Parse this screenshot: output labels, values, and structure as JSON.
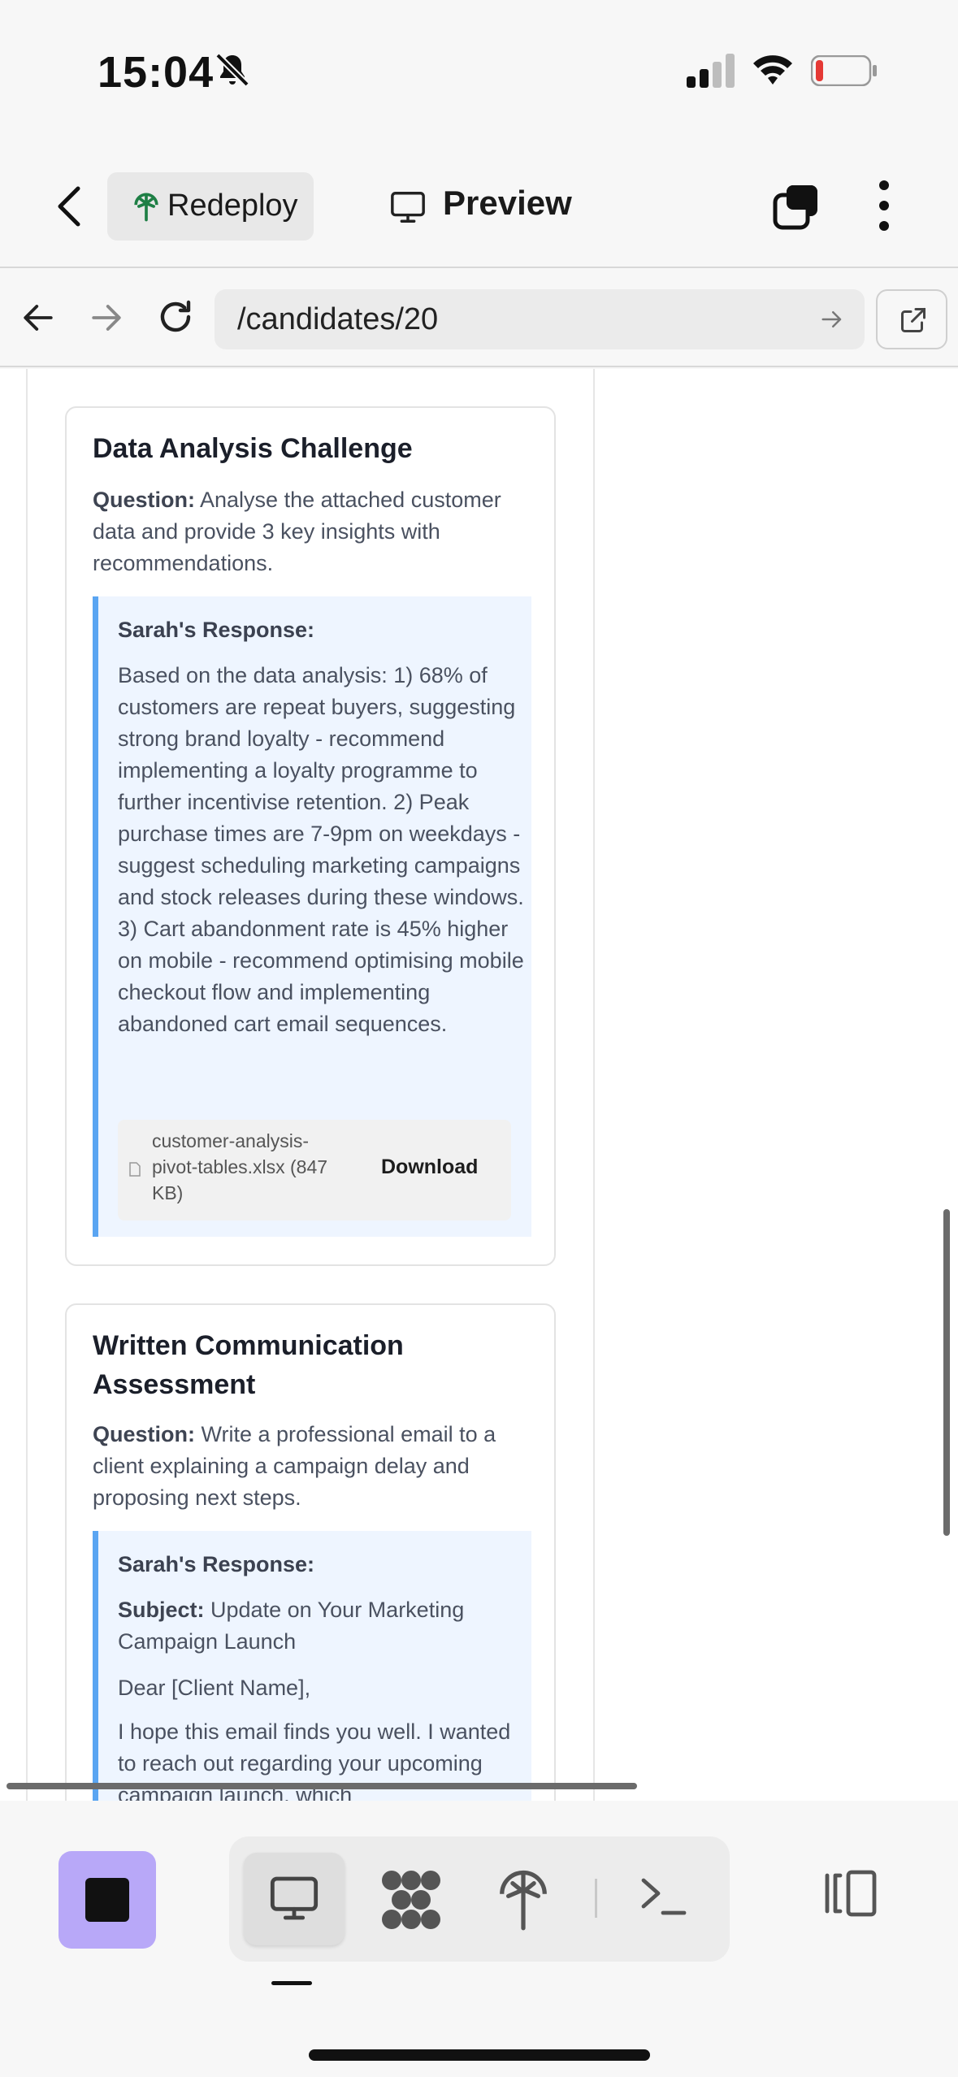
{
  "status_bar": {
    "time": "15:04",
    "battery_level": 0.12,
    "battery_color": "#e53935"
  },
  "header": {
    "redeploy_label": "Redeploy",
    "preview_label": "Preview"
  },
  "url_bar": {
    "url": "/candidates/20"
  },
  "cards": [
    {
      "title": "Data Analysis Challenge",
      "question_label": "Question:",
      "question_text": " Analyse the attached customer data and provide 3 key insights with recommendations.",
      "response_heading": "Sarah's Response:",
      "response_text": "Based on the data analysis: 1) 68% of customers are repeat buyers, suggesting strong brand loyalty - recommend implementing a loyalty programme to further incentivise retention. 2) Peak purchase times are 7-9pm on weekdays - suggest scheduling marketing campaigns and stock releases during these windows. 3) Cart abandonment rate is 45% higher on mobile - recommend optimising mobile checkout flow and implementing abandoned cart email sequences.",
      "attachment": {
        "filename": "customer-analysis-pivot-tables.xlsx (847 KB)",
        "download_label": "Download"
      }
    },
    {
      "title": "Written Communication Assessment",
      "question_label": "Question:",
      "question_text": " Write a professional email to a client explaining a campaign delay and proposing next steps.",
      "response_heading": "Sarah's Response:",
      "subject_label": "Subject:",
      "subject_text": " Update on Your Marketing Campaign Launch",
      "greeting": "Dear [Client Name],",
      "body_text": "I hope this email finds you well. I wanted to reach out regarding your upcoming campaign launch, which"
    }
  ],
  "colors": {
    "accent": "#5aa5f2",
    "response_bg": "#eef5ff",
    "stop_button": "#b8a8f8"
  },
  "icons": [
    "bell-slash-icon",
    "signal-icon",
    "wifi-icon",
    "battery-icon",
    "chevron-left-icon",
    "tree-deploy-icon",
    "monitor-icon",
    "tabs-icon",
    "more-vertical-icon",
    "arrow-left-icon",
    "arrow-right-icon",
    "reload-icon",
    "external-link-icon",
    "file-icon",
    "apps-icon",
    "deploy-icon",
    "terminal-icon",
    "panel-toggle-icon"
  ]
}
